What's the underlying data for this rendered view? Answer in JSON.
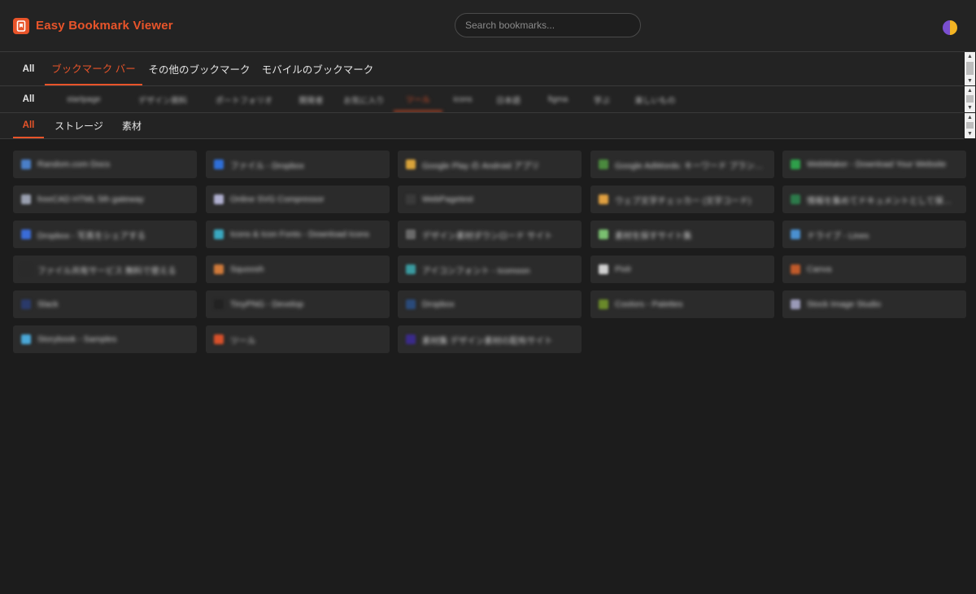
{
  "header": {
    "app_title": "Easy Bookmark Viewer",
    "search_placeholder": "Search bookmarks...",
    "accent_color": "#e8542a"
  },
  "folder_tabs": [
    {
      "label": "All",
      "active": false
    },
    {
      "label": "ブックマーク バー",
      "active": true
    },
    {
      "label": "その他のブックマーク",
      "active": false
    },
    {
      "label": "モバイルのブックマーク",
      "active": false
    }
  ],
  "subfolder_tabs": [
    {
      "label": "All",
      "active": false
    },
    {
      "label": "startpage",
      "active": false
    },
    {
      "label": "デザイン資料",
      "active": false
    },
    {
      "label": "ポートフォリオ",
      "active": false
    },
    {
      "label": "開発者",
      "active": false
    },
    {
      "label": "お気に入り",
      "active": false
    },
    {
      "label": "ツール",
      "active": true
    },
    {
      "label": "icons",
      "active": false
    },
    {
      "label": "日本語",
      "active": false
    },
    {
      "label": "figma",
      "active": false
    },
    {
      "label": "学ぶ",
      "active": false
    },
    {
      "label": "楽しいもの",
      "active": false
    }
  ],
  "category_tabs": [
    {
      "label": "All",
      "active": true
    },
    {
      "label": "ストレージ",
      "active": false
    },
    {
      "label": "素材",
      "active": false
    }
  ],
  "bookmarks": [
    {
      "label": "Random.com Docs",
      "color": "#4a7fc8"
    },
    {
      "label": "ファイル - Dropbox",
      "color": "#2f6fd8"
    },
    {
      "label": "Google Play の Android アプリ",
      "color": "#d9a33a"
    },
    {
      "label": "Google AdWords: キーワード プランナー",
      "color": "#4b8a3e"
    },
    {
      "label": "WebMaker - Download Your Website",
      "color": "#2fa04a"
    },
    {
      "label": "freeCAD HTML 5th gateway",
      "color": "#9aa0b0"
    },
    {
      "label": "Online SVG Compressor",
      "color": "#b0b0d0"
    },
    {
      "label": "WebPagetest",
      "color": "#3a3a3a"
    },
    {
      "label": "ウェブ文字チェッカー (文字コード)",
      "color": "#e0a040"
    },
    {
      "label": "情報を集めてドキュメントとして保存する",
      "color": "#2d7a4a"
    },
    {
      "label": "Dropbox - 写真をシェアする",
      "color": "#3a6cd8"
    },
    {
      "label": "Icons & Icon Fonts - Download Icons",
      "color": "#3aa8c0"
    },
    {
      "label": "デザイン素材ダウンロード サイト",
      "color": "#6a6a6a"
    },
    {
      "label": "素材を探すサイト集",
      "color": "#7ac070"
    },
    {
      "label": "ドライブ - Lines",
      "color": "#4a90d0"
    },
    {
      "label": "ファイル共有サービス 無料で使える",
      "color": "#2a2a2a"
    },
    {
      "label": "Squoosh",
      "color": "#d07a3a"
    },
    {
      "label": "アイコンフォント - Icomoon",
      "color": "#3a9aa0"
    },
    {
      "label": "Pixlr",
      "color": "#d0d0d0"
    },
    {
      "label": "Canva",
      "color": "#c05a2a"
    },
    {
      "label": "Slack",
      "color": "#2a3a6a"
    },
    {
      "label": "TinyPNG - Develop",
      "color": "#222222"
    },
    {
      "label": "Dropbox",
      "color": "#2a4a7a"
    },
    {
      "label": "Coolors - Palettes",
      "color": "#6a8a2a"
    },
    {
      "label": "Stock Image Studio",
      "color": "#9a9ab8"
    },
    {
      "label": "Storybook - Samples",
      "color": "#4aa8d8"
    },
    {
      "label": "ツール",
      "color": "#d8502a"
    },
    {
      "label": "素材集 デザイン素材の配布サイト",
      "color": "#3a2a8a"
    }
  ]
}
